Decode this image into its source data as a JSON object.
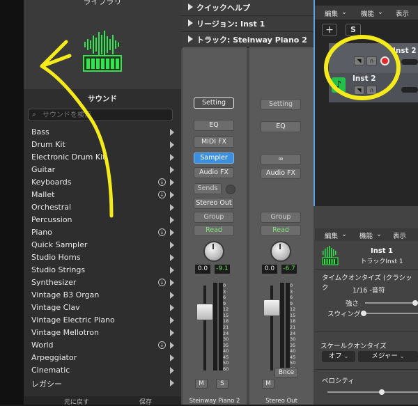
{
  "library": {
    "title": "ライブラリ",
    "sound_header": "サウンド",
    "search_placeholder": "サウンドを検索",
    "categories": [
      {
        "label": "Bass",
        "download": false
      },
      {
        "label": "Drum Kit",
        "download": false
      },
      {
        "label": "Electronic Drum Kit",
        "download": false
      },
      {
        "label": "Guitar",
        "download": false
      },
      {
        "label": "Keyboards",
        "download": true
      },
      {
        "label": "Mallet",
        "download": true
      },
      {
        "label": "Orchestral",
        "download": false
      },
      {
        "label": "Percussion",
        "download": false
      },
      {
        "label": "Piano",
        "download": true
      },
      {
        "label": "Quick Sampler",
        "download": false
      },
      {
        "label": "Studio Horns",
        "download": false
      },
      {
        "label": "Studio Strings",
        "download": false
      },
      {
        "label": "Synthesizer",
        "download": true
      },
      {
        "label": "Vintage B3 Organ",
        "download": false
      },
      {
        "label": "Vintage Clav",
        "download": false
      },
      {
        "label": "Vintage Electric Piano",
        "download": false
      },
      {
        "label": "Vintage Mellotron",
        "download": false
      },
      {
        "label": "World",
        "download": true
      },
      {
        "label": "Arpeggiator",
        "download": false
      },
      {
        "label": "Cinematic",
        "download": false
      },
      {
        "label": "レガシー",
        "download": false
      }
    ],
    "bottom_left": "元に戻す",
    "bottom_right": "保存"
  },
  "inspector": {
    "rows": [
      {
        "label": "クイックヘルプ"
      },
      {
        "label": "リージョン: Inst 1"
      },
      {
        "label": "トラック: Steinway Piano 2"
      }
    ],
    "strip1": {
      "setting": "Setting",
      "eq": "EQ",
      "midi_fx": "MIDI FX",
      "sampler": "Sampler",
      "audio_fx": "Audio FX",
      "sends": "Sends",
      "output": "Stereo Out",
      "group": "Group",
      "automation": "Read",
      "pan_val": "0.0",
      "level_val": "-9.1",
      "mute": "M",
      "solo": "S",
      "name": "Steinway Piano 2"
    },
    "strip2": {
      "setting": "Setting",
      "eq": "EQ",
      "link": "∞",
      "audio_fx": "Audio FX",
      "group": "Group",
      "automation": "Read",
      "pan_val": "0.0",
      "level_val": "-6.7",
      "mute": "M",
      "bounce": "Bnce",
      "name": "Stereo Out"
    },
    "meter_ticks": [
      "0",
      "3",
      "6",
      "9",
      "12",
      "15",
      "18",
      "21",
      "24",
      "30",
      "35",
      "40",
      "45",
      "50",
      "60"
    ]
  },
  "tracks": {
    "menu": [
      "編集",
      "機能",
      "表示"
    ],
    "add": "+",
    "s": "S",
    "track1_name": "Inst 2",
    "track2_name": "Inst 2"
  },
  "lower": {
    "menu": [
      "編集",
      "機能",
      "表示"
    ],
    "inst_name": "Inst 1",
    "inst_sub": "トラックInst 1",
    "time_quantize": "タイムクオンタイズ (クラシック",
    "quantize_val": "1/16 -音符",
    "strength": "強さ",
    "swing": "スウィング",
    "scale_quantize": "スケールクオンタイズ",
    "scale_off": "オフ",
    "scale_major": "メジャー",
    "velocity": "ベロシティ"
  },
  "colors": {
    "selection_blue": "#5aa2e5",
    "instrument_green": "#22c04a",
    "annotation_yellow": "#f5ea1a",
    "record_red": "#e02a2a"
  }
}
